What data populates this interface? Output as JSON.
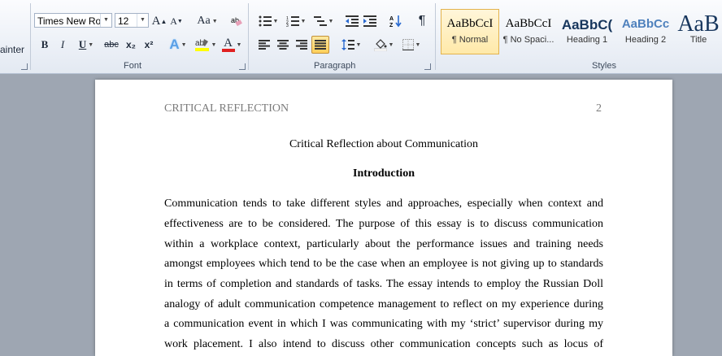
{
  "clipboard": {
    "format_painter_label": "ainter"
  },
  "font": {
    "group_label": "Font",
    "font_name": "Times New Rom",
    "font_size": "12",
    "grow": "A",
    "shrink": "A",
    "change_case": "Aa",
    "bold": "B",
    "italic": "I",
    "underline": "U",
    "strikethrough": "abc",
    "subscript": "x₂",
    "superscript": "x²",
    "text_effects": "A",
    "font_color": "A",
    "highlight_color": "#ffff00",
    "font_color_value": "#e02020"
  },
  "paragraph": {
    "group_label": "Paragraph",
    "show_marks": "¶"
  },
  "styles": {
    "group_label": "Styles",
    "items": [
      {
        "sample": "AaBbCcI",
        "name": "¶ Normal"
      },
      {
        "sample": "AaBbCcI",
        "name": "¶ No Spaci..."
      },
      {
        "sample": "AaBbC(",
        "name": "Heading 1"
      },
      {
        "sample": "AaBbCc",
        "name": "Heading 2"
      },
      {
        "sample": "AaB",
        "name": "Title"
      }
    ]
  },
  "document": {
    "running_head": "CRITICAL REFLECTION",
    "page_number": "2",
    "title": "Critical Reflection about Communication",
    "heading": "Introduction",
    "lines": [
      "Communication tends to take different styles and approaches, especially when context and",
      "effectiveness are to be considered. The purpose of this essay is to discuss communication",
      "within a workplace context, particularly about the performance issues and training needs",
      "amongst employees which tend to be the case when an employee is not giving up to standards",
      "in terms of completion and standards of tasks. The essay intends to employ the Russian Doll",
      "analogy of adult communication competence management to reflect on my experience during",
      "a communication event in which I was communicating with my ‘strict’ supervisor during my",
      "work placement. I also intend to discuss other communication concepts such as locus of"
    ]
  }
}
